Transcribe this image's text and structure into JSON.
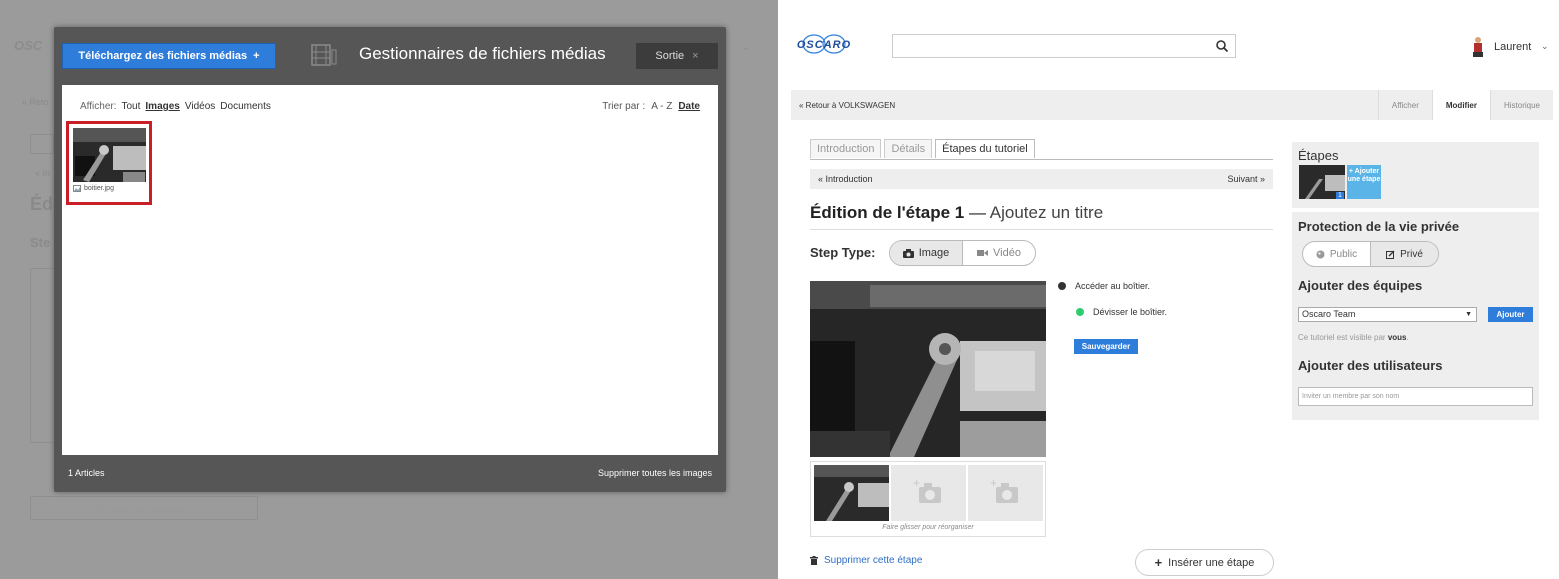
{
  "left": {
    "upload_label": "Téléchargez des fichiers médias",
    "upload_plus": "+",
    "modal_title": "Gestionnaires de fichiers médias",
    "exit_label": "Sortie",
    "exit_x": "×",
    "filter_label": "Afficher:",
    "filters": [
      "Tout",
      "Images",
      "Vidéos",
      "Documents"
    ],
    "sort_label": "Trier par :",
    "sort_options": [
      "A - Z",
      "Date"
    ],
    "file_name": "boitier.jpg",
    "footer_count": "1 Articles",
    "footer_delete": "Supprimer toutes les images",
    "bg_step_label": "Ste",
    "bg_title_fragment": "Éd",
    "bg_drag_hint": "Faire glisser pour réorganiser"
  },
  "right": {
    "logo_text": "OSCARO",
    "user_name": "Laurent",
    "back_link": "« Retour à VOLKSWAGEN",
    "view_tabs": [
      "Afficher",
      "Modifier",
      "Historique"
    ],
    "tabs": [
      "Introduction",
      "Détails",
      "Étapes du tutoriel"
    ],
    "nav_prev": "« Introduction",
    "nav_next": "Suivant »",
    "step_title_bold": "Édition de l'étape 1",
    "step_title_dash": " — ",
    "step_title_rest": "Ajoutez un titre",
    "step_type_label": "Step Type:",
    "step_type_image": "Image",
    "step_type_video": "Vidéo",
    "bullet_1": "Accéder au boîtier.",
    "bullet_2": "Dévisser le boîtier.",
    "save_label": "Sauvegarder",
    "drag_hint": "Faire glisser pour réorganiser",
    "delete_step": "Supprimer cette étape",
    "insert_step": "Insérer une étape",
    "sidebar": {
      "steps_heading": "Étapes",
      "step_number": "1",
      "add_step": "+ Ajouter une étape",
      "privacy_heading": "Protection de la vie privée",
      "privacy_public": "Public",
      "privacy_private": "Privé",
      "teams_heading": "Ajouter des équipes",
      "team_selected": "Oscaro Team",
      "add_team": "Ajouter",
      "visibility_prefix": "Ce tutoriel est visible par ",
      "visibility_who": "vous",
      "visibility_suffix": ".",
      "users_heading": "Ajouter des utilisateurs",
      "invite_placeholder": "Inviter un membre par son nom"
    }
  },
  "colors": {
    "accent": "#2f7ddb",
    "highlight": "#c91f27",
    "bullet_dark": "#333333",
    "bullet_green": "#2ecc71"
  }
}
